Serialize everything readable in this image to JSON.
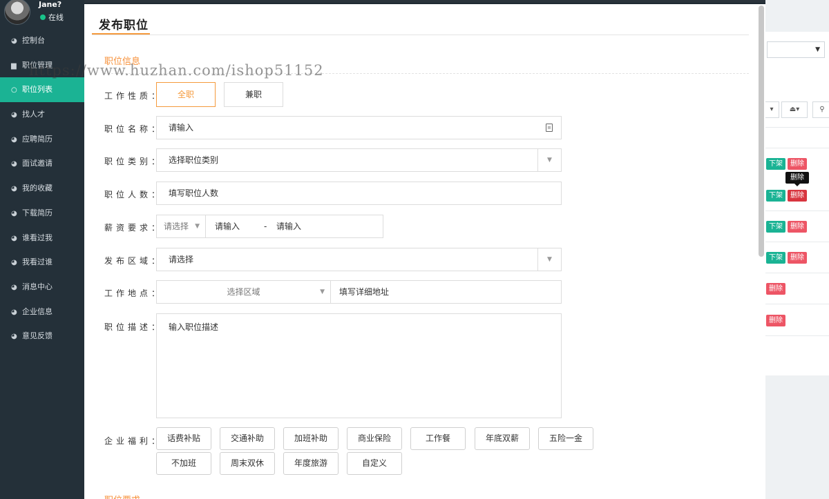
{
  "sidebar": {
    "user": {
      "name": "Jane?",
      "status": "在线"
    },
    "items": [
      {
        "label": "控制台",
        "icon": "dashboard-icon"
      },
      {
        "label": "职位管理",
        "icon": "briefcase-icon"
      },
      {
        "label": "职位列表",
        "icon": "circle-icon",
        "active": true
      },
      {
        "label": "找人才",
        "icon": "dashboard-icon"
      },
      {
        "label": "应聘简历",
        "icon": "dashboard-icon"
      },
      {
        "label": "面试邀请",
        "icon": "dashboard-icon"
      },
      {
        "label": "我的收藏",
        "icon": "dashboard-icon"
      },
      {
        "label": "下载简历",
        "icon": "dashboard-icon"
      },
      {
        "label": "谁看过我",
        "icon": "dashboard-icon"
      },
      {
        "label": "我看过谁",
        "icon": "dashboard-icon"
      },
      {
        "label": "消息中心",
        "icon": "dashboard-icon"
      },
      {
        "label": "企业信息",
        "icon": "dashboard-icon"
      },
      {
        "label": "意见反馈",
        "icon": "dashboard-icon"
      }
    ]
  },
  "background": {
    "row_actions": {
      "offline": "下架",
      "delete": "删除"
    },
    "tooltip": "删除"
  },
  "watermark": "https://www.huzhan.com/ishop51152",
  "modal": {
    "title": "发布职位",
    "section_info": "职位信息",
    "section_requirements": "职位要求",
    "job_nature": {
      "label": "工作性质：",
      "options": [
        "全职",
        "兼职"
      ]
    },
    "job_name": {
      "label": "职位名称：",
      "placeholder": "请输入"
    },
    "job_category": {
      "label": "职位类别：",
      "value": "选择职位类别"
    },
    "headcount": {
      "label": "职位人数：",
      "placeholder": "填写职位人数"
    },
    "salary": {
      "label": "薪资要求：",
      "select": "请选择",
      "min_placeholder": "请输入",
      "dash": "-",
      "max_placeholder": "请输入"
    },
    "region": {
      "label": "发布区域：",
      "value": "请选择"
    },
    "location": {
      "label": "工作地点：",
      "area": "选择区域",
      "address_placeholder": "填写详细地址"
    },
    "description": {
      "label": "职位描述：",
      "placeholder": "输入职位描述"
    },
    "benefits": {
      "label": "企业福利：",
      "row1": [
        "话费补贴",
        "交通补助",
        "加班补助",
        "商业保险",
        "工作餐",
        "年底双薪",
        "五险一金"
      ],
      "row2": [
        "不加班",
        "周末双休",
        "年度旅游",
        "自定义"
      ]
    }
  }
}
